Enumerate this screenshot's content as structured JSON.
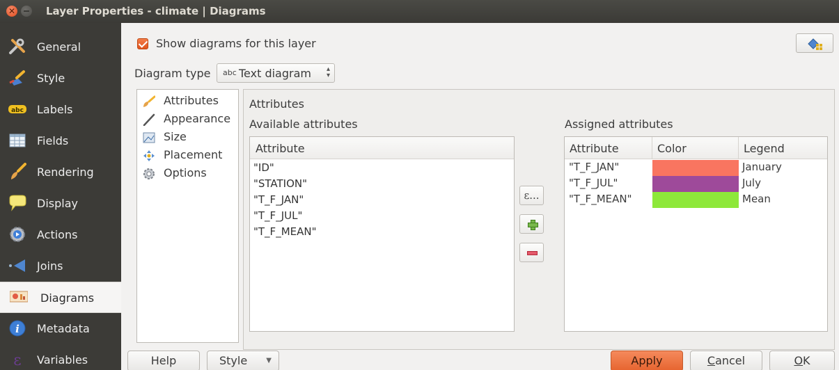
{
  "window": {
    "title": "Layer Properties - climate | Diagrams",
    "close_glyph": "✕"
  },
  "sidebar": {
    "items": [
      {
        "label": "General",
        "icon": "wrench-screwdriver-icon",
        "active": false
      },
      {
        "label": "Style",
        "icon": "paintbrush-icon",
        "active": false
      },
      {
        "label": "Labels",
        "icon": "abc-label-icon",
        "active": false
      },
      {
        "label": "Fields",
        "icon": "table-fields-icon",
        "active": false
      },
      {
        "label": "Rendering",
        "icon": "brush-icon",
        "active": false
      },
      {
        "label": "Display",
        "icon": "speech-bubble-icon",
        "active": false
      },
      {
        "label": "Actions",
        "icon": "gear-play-icon",
        "active": false
      },
      {
        "label": "Joins",
        "icon": "joins-icon",
        "active": false
      },
      {
        "label": "Diagrams",
        "icon": "diagram-icon",
        "active": true
      },
      {
        "label": "Metadata",
        "icon": "info-icon",
        "active": false
      },
      {
        "label": "Variables",
        "icon": "epsilon-icon",
        "active": false
      }
    ]
  },
  "main": {
    "show_diagrams_label": "Show diagrams for this layer",
    "show_diagrams_checked": true,
    "diagram_type_label": "Diagram type",
    "diagram_type_value": "Text diagram",
    "diagram_type_icon_text": "abc"
  },
  "subnav": {
    "items": [
      {
        "label": "Attributes",
        "icon": "brush-icon",
        "selected": true
      },
      {
        "label": "Appearance",
        "icon": "pen-icon",
        "selected": false
      },
      {
        "label": "Size",
        "icon": "size-icon",
        "selected": false
      },
      {
        "label": "Placement",
        "icon": "placement-icon",
        "selected": false
      },
      {
        "label": "Options",
        "icon": "options-gear-icon",
        "selected": false
      }
    ]
  },
  "attributes": {
    "section_title": "Attributes",
    "available_title": "Available attributes",
    "assigned_title": "Assigned attributes",
    "available_header": "Attribute",
    "available": [
      "\"ID\"",
      "\"STATION\"",
      "\"T_F_JAN\"",
      "\"T_F_JUL\"",
      "\"T_F_MEAN\""
    ],
    "expression_button": "ε...",
    "assigned_headers": [
      "Attribute",
      "Color",
      "Legend"
    ],
    "assigned": [
      {
        "attribute": "\"T_F_JAN\"",
        "color": "#f97560",
        "legend": "January"
      },
      {
        "attribute": "\"T_F_JUL\"",
        "color": "#9e4a9a",
        "legend": "July"
      },
      {
        "attribute": "\"T_F_MEAN\"",
        "color": "#8ee83a",
        "legend": "Mean"
      }
    ]
  },
  "buttons": {
    "help": "Help",
    "style": "Style",
    "apply": "Apply",
    "cancel_prefix": "",
    "cancel_mnemonic": "C",
    "cancel_rest": "ancel",
    "ok_mnemonic": "O",
    "ok_rest": "K"
  },
  "colors": {
    "accent": "#e6642f",
    "sidebar_bg": "#3c3b37"
  }
}
